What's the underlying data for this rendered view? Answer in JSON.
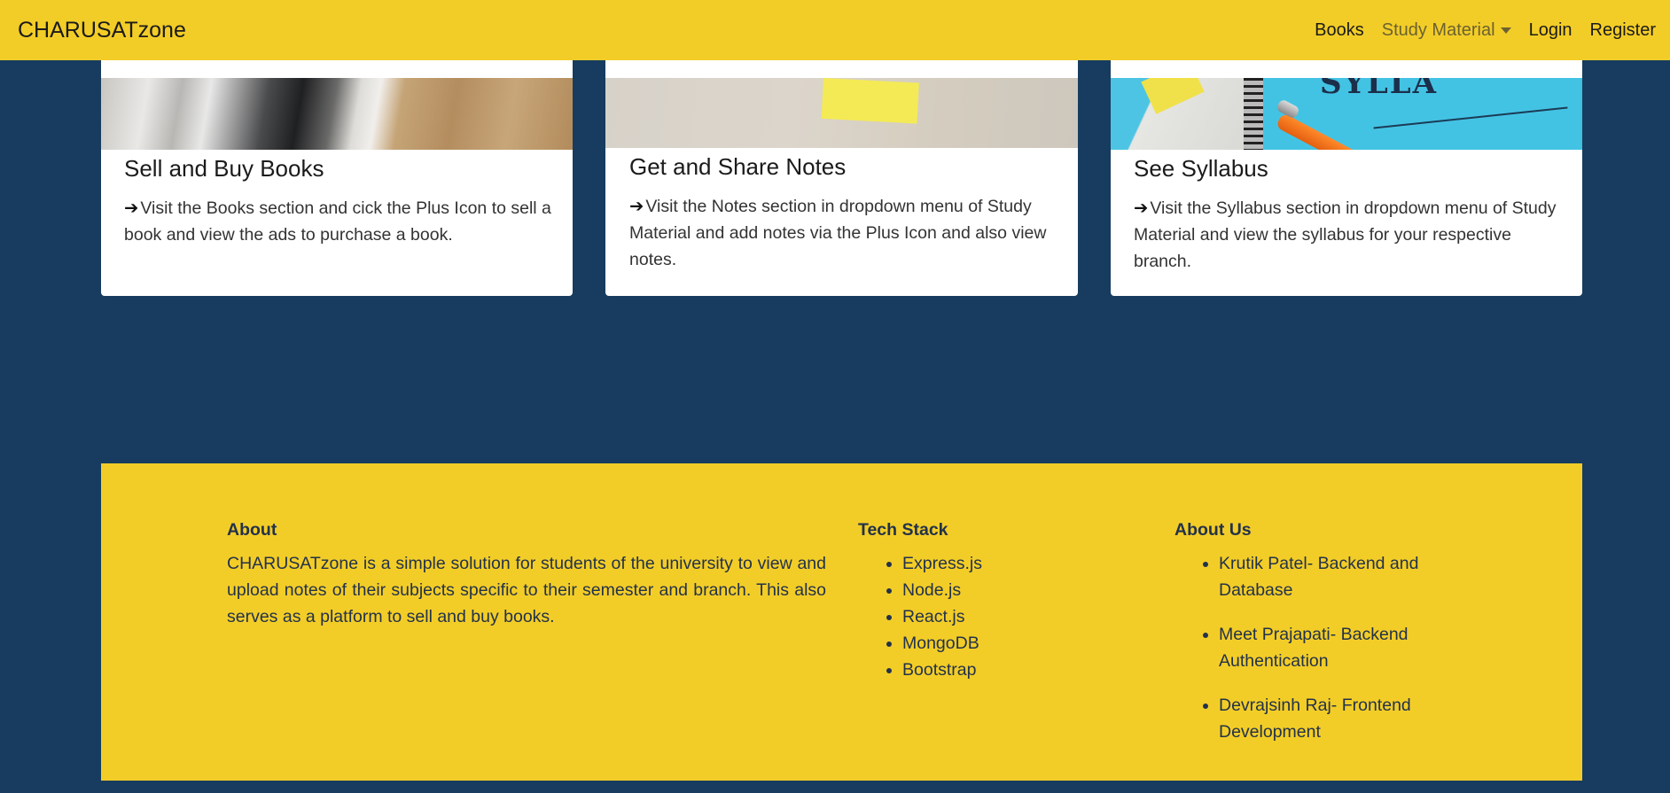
{
  "navbar": {
    "brand": "CHARUSATzone",
    "links": {
      "books": "Books",
      "study_material": "Study Material",
      "login": "Login",
      "register": "Register"
    }
  },
  "cards": [
    {
      "title": "Sell and Buy Books",
      "arrow": "➔",
      "text": "Visit the Books section and cick the Plus Icon to sell a book and view the ads to purchase a book."
    },
    {
      "title": "Get and Share Notes",
      "arrow": "➔",
      "text": "Visit the Notes section in dropdown menu of Study Material and add notes via the Plus Icon and also view notes."
    },
    {
      "title": "See Syllabus",
      "arrow": "➔",
      "text": "Visit the Syllabus section in dropdown menu of Study Material and view the syllabus for your respective branch.",
      "image_text": "SYLLA"
    }
  ],
  "footer": {
    "about": {
      "heading": "About",
      "text": "CHARUSATzone is a simple solution for students of the university to view and upload notes of their subjects specific to their semester and branch. This also serves as a platform to sell and buy books."
    },
    "tech_stack": {
      "heading": "Tech Stack",
      "items": [
        "Express.js",
        "Node.js",
        "React.js",
        "MongoDB",
        "Bootstrap"
      ]
    },
    "about_us": {
      "heading": "About Us",
      "items": [
        "Krutik Patel- Backend and Database",
        "Meet Prajapati- Backend Authentication",
        "Devrajsinh Raj- Frontend Development"
      ]
    }
  },
  "colors": {
    "navbar_bg": "#f3cd27",
    "page_bg": "#173c5f",
    "footer_bg": "#f3cd27",
    "card_bg": "#ffffff"
  }
}
